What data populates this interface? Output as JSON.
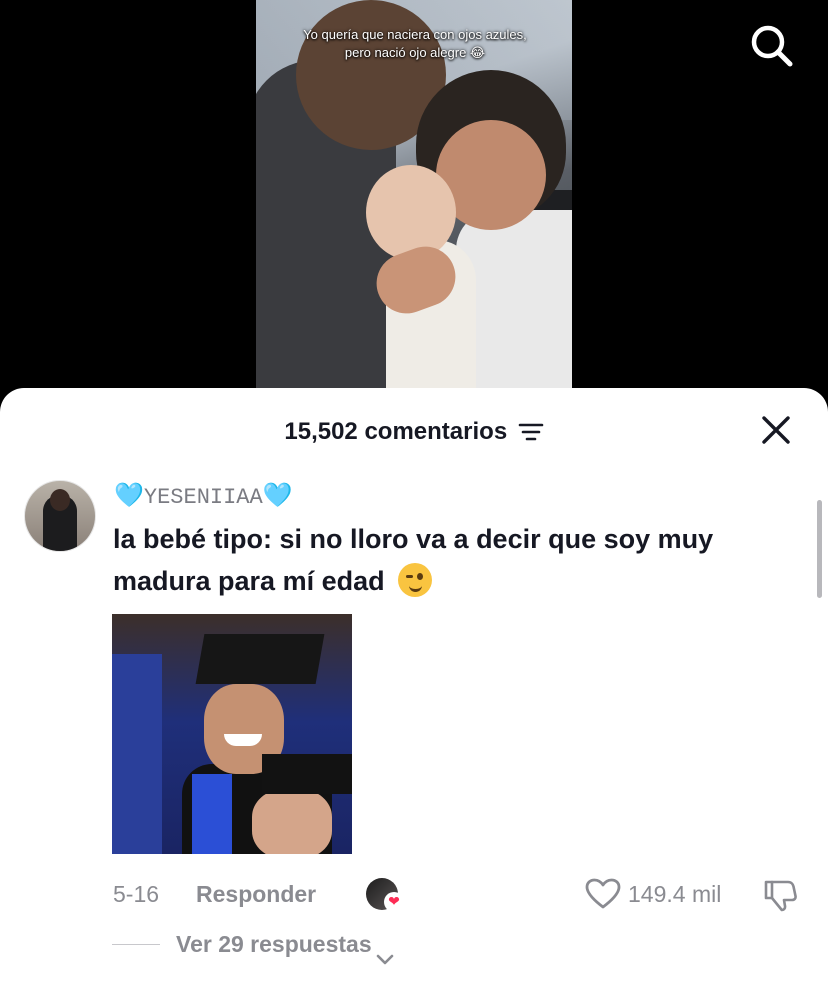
{
  "video": {
    "caption": "Yo quería que naciera con ojos azules, pero nació ojo alegre 😂",
    "search_icon": "search-icon"
  },
  "sheet": {
    "comments_count": "15,502 comentarios",
    "filter_icon": "filter-icon",
    "close_icon": "close-icon"
  },
  "comment": {
    "username_prefix": "🩵",
    "username": "YESENIIAA",
    "username_suffix": "🩵",
    "text": "la bebé tipo: si no lloro va a decir que soy muy madura para mí edad",
    "emoji": "wink-emoji",
    "date": "5-16",
    "reply_label": "Responder",
    "like_count": "149.4 mil",
    "replies_label": "Ver 29 respuestas",
    "liked_by_creator_heart": "❤"
  },
  "colors": {
    "sheet_bg": "#ffffff",
    "text_primary": "#161823",
    "text_secondary": "#8a8b91",
    "heart_accent": "#fe2c55",
    "username_heart": "#6ec3f2"
  }
}
